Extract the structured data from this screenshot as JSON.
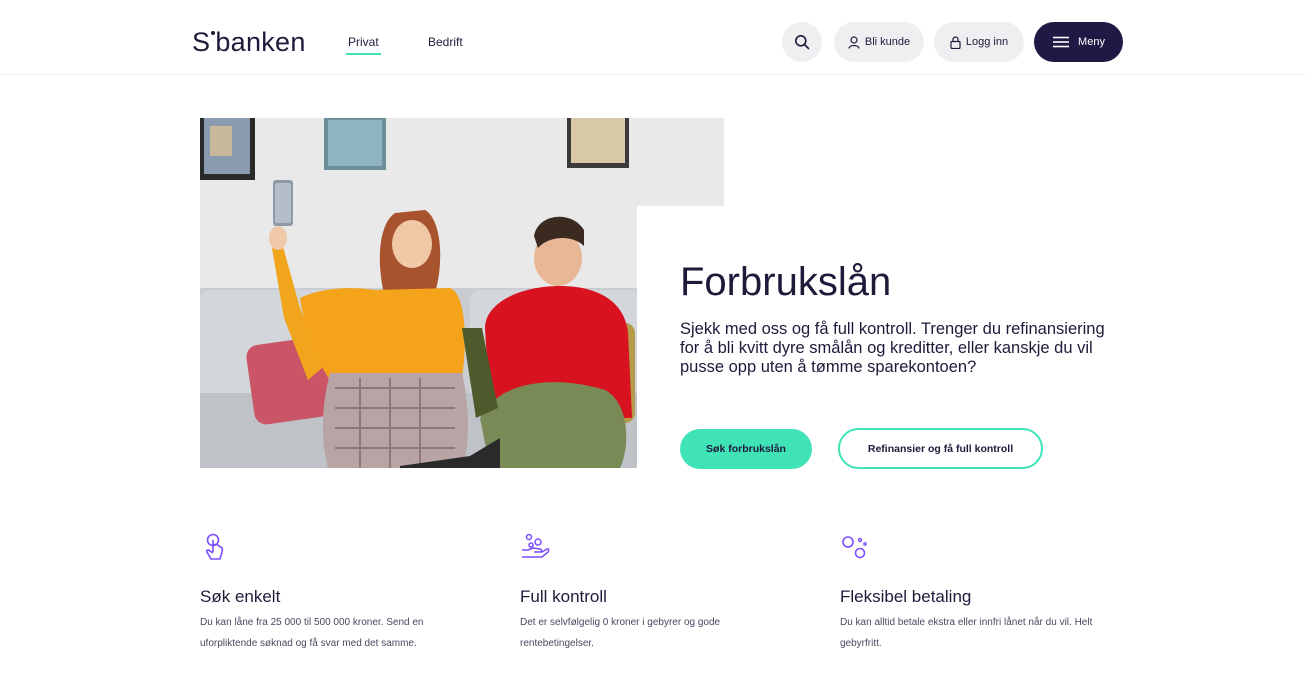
{
  "header": {
    "logo": "S",
    "logo_suffix": "banken",
    "nav": [
      {
        "label": "Privat",
        "active": true
      },
      {
        "label": "Bedrift",
        "active": false
      }
    ],
    "search_icon": "search-icon",
    "bli_kunde": "Bli kunde",
    "logg_inn": "Logg inn",
    "meny": "Meny"
  },
  "hero": {
    "title": "Forbrukslån",
    "text": "Sjekk med oss og få full kontroll. Trenger du refinansiering for å bli kvitt dyre smålån og kreditter, eller kanskje du vil pusse opp uten å tømme sparekontoen?",
    "primary_button": "Søk forbrukslån",
    "secondary_button": "Refinansier og få full kontroll"
  },
  "features": [
    {
      "icon": "touch-icon",
      "title": "Søk enkelt",
      "text": "Du kan låne fra 25 000 til 500 000 kroner. Send en uforpliktende søknad og få svar med det samme."
    },
    {
      "icon": "hand-coins-icon",
      "title": "Full kontroll",
      "text": "Det er selvfølgelig 0 kroner i gebyrer og gode rentebetingelser."
    },
    {
      "icon": "circles-icon",
      "title": "Fleksibel betaling",
      "text": "Du kan alltid betale ekstra eller innfri lånet når du vil. Helt gebyrfritt."
    }
  ],
  "colors": {
    "accent": "#3fe3b6",
    "navy": "#1f1a45",
    "icon_purple": "#7c4dff"
  }
}
